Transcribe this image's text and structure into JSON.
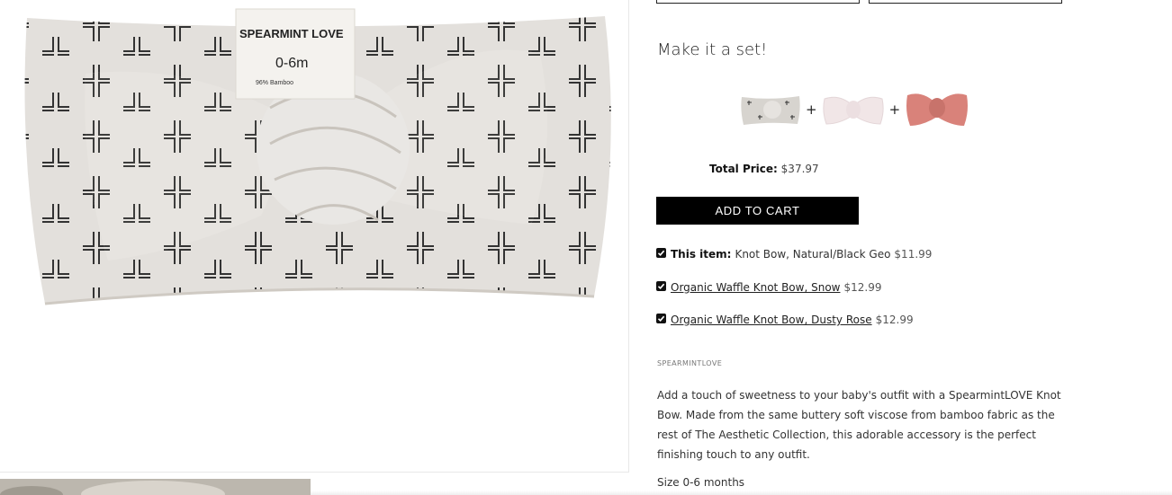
{
  "product_image": {
    "label": {
      "brand": "SPEARMINT LOVE",
      "size": "0-6m",
      "material": "96% Bamboo"
    }
  },
  "bundle": {
    "title": "Make it a set!",
    "plus": "+",
    "images": [
      "Knot Bow, Natural/Black Geo",
      "Organic Waffle Knot Bow, Snow",
      "Organic Waffle Knot Bow, Dusty Rose"
    ],
    "total_label": "Total Price:",
    "total_value": "$37.97",
    "add_to_cart": "ADD TO CART",
    "items": [
      {
        "prefix": "This item:",
        "name": "Knot Bow, Natural/Black Geo",
        "price": "$11.99",
        "checked": true
      },
      {
        "name": "Organic Waffle Knot Bow, Snow",
        "price": "$12.99",
        "checked": true
      },
      {
        "name": "Organic Waffle Knot Bow, Dusty Rose",
        "price": "$12.99",
        "checked": true
      }
    ]
  },
  "product": {
    "vendor": "SPEARMINTLOVE",
    "description": "Add a touch of sweetness to your baby's outfit with a SpearmintLOVE Knot Bow. Made from the same buttery soft viscose from bamboo fabric as the rest of The Aesthetic Collection, this adorable accessory is the perfect finishing touch to any outfit.",
    "size": "Size 0-6 months"
  },
  "colors": {
    "button_bg": "#000000",
    "fabric": "#e3e0dc",
    "snow": "#f1e6e7",
    "dusty_rose": "#d9827a"
  }
}
